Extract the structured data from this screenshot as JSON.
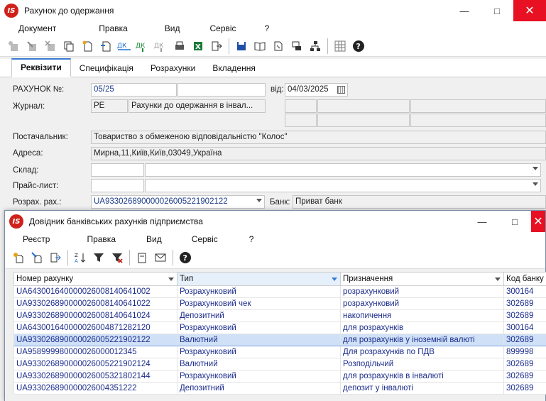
{
  "main_window": {
    "title": "Рахунок до одержання",
    "menu": [
      "Документ",
      "Правка",
      "Вид",
      "Сервіс",
      "?"
    ],
    "tabs": [
      "Реквізити",
      "Специфікація",
      "Розрахунки",
      "Вкладення"
    ],
    "form": {
      "invoice_label": "РАХУНОК №:",
      "invoice_number": "05/25",
      "date_label": "від:",
      "date": "04/03/2025",
      "journal_label": "Журнал:",
      "journal_code": "РЕ",
      "journal_name": "Рахунки до одержання в інвал...",
      "supplier_label": "Постачальник:",
      "supplier": "Товариство з обмеженою відповідальністю \"Колос\"",
      "address_label": "Адреса:",
      "address": "Мирна,11,Київ,Київ,03049,Україна",
      "warehouse_label": "Склад:",
      "pricelist_label": "Прайс-лист:",
      "account_label": "Розрах. рах.:",
      "account": "UA933026890000026005221902122",
      "bank_label": "Банк:",
      "bank": "Приват банк"
    }
  },
  "dialog": {
    "title": "Довідник банківських рахунків підприємства",
    "menu": [
      "Реєстр",
      "Правка",
      "Вид",
      "Сервіс",
      "?"
    ],
    "columns": [
      "Номер рахунку",
      "Тип",
      "Призначення",
      "Код банку"
    ],
    "rows": [
      [
        "UA643001640000026008140641002",
        "Розрахунковий",
        "розрахунковий",
        "300164"
      ],
      [
        "UA933026890000026008140641022",
        "Розрахунковий чек",
        "розрахунковий",
        "302689"
      ],
      [
        "UA933026890000026008140641024",
        "Депозитний",
        "накопичення",
        "302689"
      ],
      [
        "UA643001640000026004871282120",
        "Розрахунковий",
        "для розрахунків",
        "300164"
      ],
      [
        "UA933026890000026005221902122",
        "Валютний",
        "для розрахунків у іноземній валюті",
        "302689"
      ],
      [
        "UA958999980000026000012345",
        "Розрахунковий",
        "Для розрахунків по ПДВ",
        "899998"
      ],
      [
        "UA933026890000026005221902124",
        "Валютний",
        "Розподільчий",
        "302689"
      ],
      [
        "UA933026890000026005321802144",
        "Розрахунковий",
        "для розрахунків в інвалюті",
        "302689"
      ],
      [
        "UA933026890000026004351222",
        "Депозитний",
        "депозит у інвалюті",
        "302689"
      ]
    ],
    "selected_row": 4
  },
  "colors": {
    "accent": "#3a7bd5",
    "selection": "#cfe0f7",
    "link_text": "#1c2d8c",
    "close_button": "#e81123"
  }
}
